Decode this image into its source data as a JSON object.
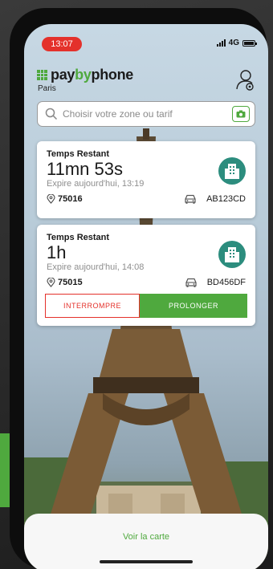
{
  "status_bar": {
    "time": "13:07",
    "network": "4G"
  },
  "brand": {
    "name_part1": "pay",
    "name_part2": "by",
    "name_part3": "phone",
    "city": "Paris"
  },
  "search": {
    "placeholder": "Choisir votre zone ou tarif"
  },
  "sessions": [
    {
      "label": "Temps Restant",
      "remaining": "11mn 53s",
      "expires": "Expire aujourd'hui, 13:19",
      "zone": "75016",
      "plate": "AB123CD"
    },
    {
      "label": "Temps Restant",
      "remaining": "1h",
      "expires": "Expire aujourd'hui, 14:08",
      "zone": "75015",
      "plate": "BD456DF",
      "stop_label": "INTERROMPRE",
      "extend_label": "PROLONGER"
    }
  ],
  "footer": {
    "map_link": "Voir la carte"
  },
  "colors": {
    "brand_green": "#4fa93e",
    "alert_red": "#e4312b",
    "building_teal": "#2c8d7e"
  },
  "icons": [
    "settings-user-icon",
    "search-icon",
    "camera-icon",
    "location-pin-icon",
    "car-icon",
    "building-icon"
  ]
}
